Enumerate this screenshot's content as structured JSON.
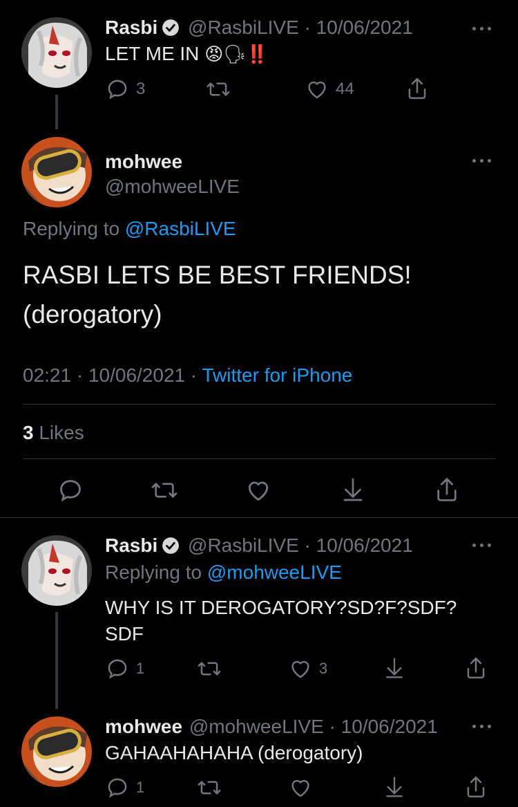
{
  "tweet1": {
    "name": "Rasbi",
    "meta": "@RasbiLIVE · 10/06/2021",
    "text": "LET ME IN",
    "emoji": "😡🗣‼️",
    "reply_count": "3",
    "like_count": "44"
  },
  "main": {
    "name": "mohwee",
    "handle": "@mohweeLIVE",
    "replying_prefix": "Replying to",
    "replying_handle": "@RasbiLIVE",
    "text_line1": "RASBI LETS BE BEST FRIENDS!",
    "text_line2": "(derogatory)",
    "timestamp": "02:21 · 10/06/2021 ·",
    "source": "Twitter for iPhone",
    "likes_count": "3",
    "likes_label": "Likes"
  },
  "tweet3": {
    "name": "Rasbi",
    "meta": "@RasbiLIVE · 10/06/2021",
    "replying_prefix": "Replying to",
    "replying_handle": "@mohweeLIVE",
    "text_line1": "WHY IS IT DEROGATORY?SD?F?SDF?",
    "text_line2": "SDF",
    "reply_count": "1",
    "like_count": "3"
  },
  "tweet4": {
    "name": "mohwee",
    "meta": "@mohweeLIVE · 10/06/2021",
    "text": "GAHAAHAHAHA (derogatory)",
    "reply_count": "1"
  },
  "colors": {
    "background": "#000000",
    "text": "#e7e9ea",
    "muted": "#71767b",
    "link": "#1d9bf0",
    "verified": "#d9d9d9"
  }
}
